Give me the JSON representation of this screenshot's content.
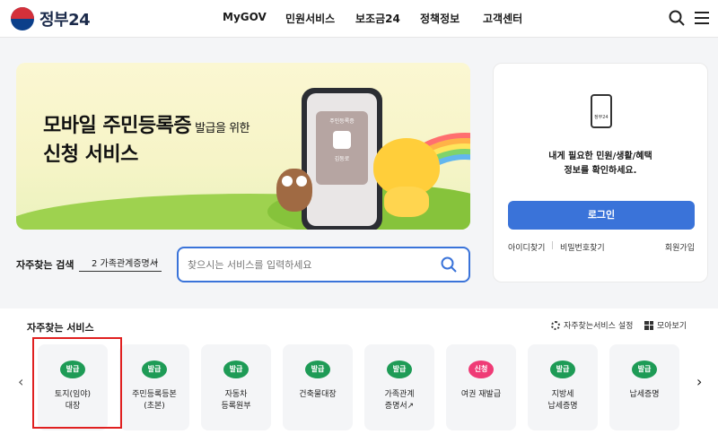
{
  "header": {
    "logo_text": "정부24",
    "nav": [
      "MyGOV",
      "민원서비스",
      "보조금24",
      "정책정보",
      "고객센터"
    ],
    "icons": [
      "search-icon",
      "hamburger-menu-icon"
    ]
  },
  "banner": {
    "title_main": "모바일 주민등록증",
    "title_sub": "발급을 위한",
    "title_line2": "신청 서비스",
    "card_label": "주민등록증",
    "card_name": "김둥로"
  },
  "search": {
    "label": "자주찾는 검색",
    "selected": "2  가족관계증명서",
    "placeholder": "찾으시는 서비스를 입력하세요"
  },
  "login": {
    "app_label": "정부24",
    "message_line1": "내게 필요한 민원/생활/혜택",
    "message_line2": "정보를 확인하세요.",
    "button": "로그인",
    "find_id": "아이디찾기",
    "find_pw": "비밀번호찾기",
    "signup": "회원가입",
    "separator": "|"
  },
  "services": {
    "title": "자주찾는 서비스",
    "settings_label": "자주찾는서비스 설정",
    "view_all_label": "모아보기",
    "arrow_left": "‹",
    "arrow_right": "›",
    "items": [
      {
        "badge": "발급",
        "label": "토지(임야)\n대장",
        "badge_color": "#1e9b56"
      },
      {
        "badge": "발급",
        "label": "주민등록등본\n(초본)",
        "badge_color": "#1e9b56"
      },
      {
        "badge": "발급",
        "label": "자동차\n등록원부",
        "badge_color": "#1e9b56"
      },
      {
        "badge": "발급",
        "label": "건축물대장",
        "badge_color": "#1e9b56"
      },
      {
        "badge": "발급",
        "label": "가족관계\n증명서↗",
        "badge_color": "#1e9b56"
      },
      {
        "badge": "신청",
        "label": "여권 재발급",
        "badge_color": "#ef3b76"
      },
      {
        "badge": "발급",
        "label": "지방세\n납세증명",
        "badge_color": "#1e9b56"
      },
      {
        "badge": "발급",
        "label": "납세증명",
        "badge_color": "#1e9b56"
      }
    ]
  }
}
